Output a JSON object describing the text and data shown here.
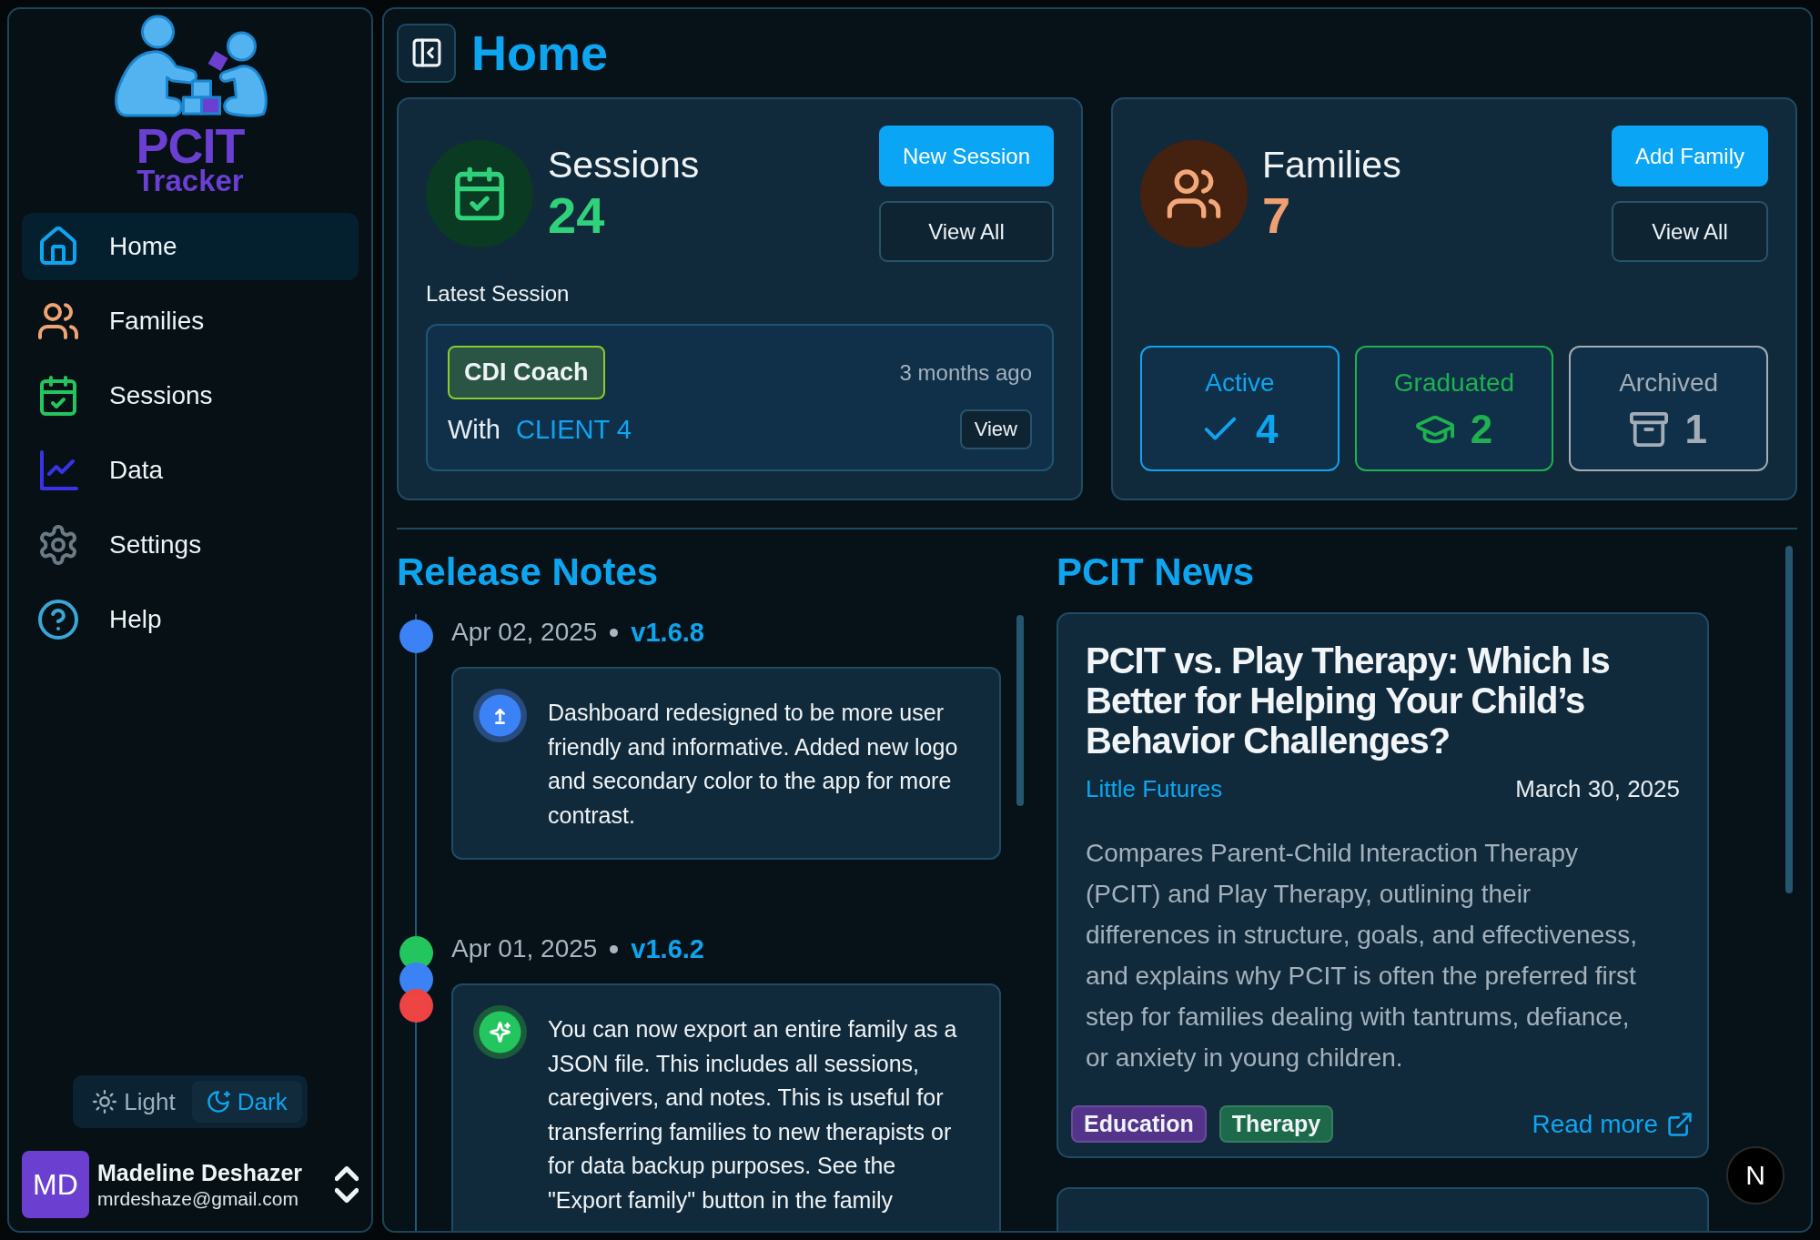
{
  "sidebar": {
    "logo": {
      "title": "PCIT",
      "subtitle": "Tracker"
    },
    "nav": [
      {
        "label": "Home",
        "selected": true
      },
      {
        "label": "Families",
        "selected": false
      },
      {
        "label": "Sessions",
        "selected": false
      },
      {
        "label": "Data",
        "selected": false
      },
      {
        "label": "Settings",
        "selected": false
      },
      {
        "label": "Help",
        "selected": false
      }
    ],
    "theme_toggle": [
      {
        "label": "Light",
        "selected": false
      },
      {
        "label": "Dark",
        "selected": true
      }
    ],
    "user": {
      "initials": "MD",
      "name": "Madeline Deshazer",
      "email": "mrdeshaze@gmail.com"
    }
  },
  "header": {
    "title": "Home"
  },
  "sessions_card": {
    "title": "Sessions",
    "count": "24",
    "primary_button": "New Session",
    "secondary_button": "View All",
    "latest_label": "Latest Session",
    "latest": {
      "badge": "CDI Coach",
      "time": "3 months ago",
      "with_label": "With",
      "client": "CLIENT 4",
      "button": "View"
    }
  },
  "families_card": {
    "title": "Families",
    "count": "7",
    "primary_button": "Add Family",
    "secondary_button": "View All",
    "stats": [
      {
        "kind": "active",
        "label": "Active",
        "value": "4"
      },
      {
        "kind": "graduated",
        "label": "Graduated",
        "value": "2"
      },
      {
        "kind": "archived",
        "label": "Archived",
        "value": "1"
      }
    ]
  },
  "release_notes": {
    "title": "Release Notes",
    "entries": [
      {
        "date": "Apr 02, 2025",
        "version": "v1.6.8",
        "kind": "update",
        "dots": [
          {
            "color": "#3b82f6"
          }
        ],
        "text": "Dashboard redesigned to be more user friendly and informative. Added new logo and secondary color to the app for more contrast."
      },
      {
        "date": "Apr 01, 2025",
        "version": "v1.6.2",
        "kind": "feature",
        "dots": [
          {
            "color": "#22c55e"
          },
          {
            "color": "#3b82f6"
          },
          {
            "color": "#ef4444"
          }
        ],
        "text": "You can now export an entire family as a JSON file. This includes all sessions, caregivers, and notes. This is useful for transferring families to new therapists or for data backup purposes. See the \"Export family\" button in the family"
      }
    ]
  },
  "news": {
    "title": "PCIT News",
    "articles": [
      {
        "title": "PCIT vs. Play Therapy: Which Is Better for Helping Your Child’s Behavior Challenges?",
        "source": "Little Futures",
        "date": "March 30, 2025",
        "summary": "Compares Parent-Child Interaction Therapy (PCIT) and Play Therapy, outlining their differences in structure, goals, and effectiveness, and explains why PCIT is often the preferred first step for families dealing with tantrums, defiance, or anxiety in young children.",
        "tags": [
          {
            "label": "Education",
            "color": "#54348a"
          },
          {
            "label": "Therapy",
            "color": "#1d6a4b"
          }
        ],
        "link": "Read more"
      }
    ]
  },
  "dev_badge": "N"
}
